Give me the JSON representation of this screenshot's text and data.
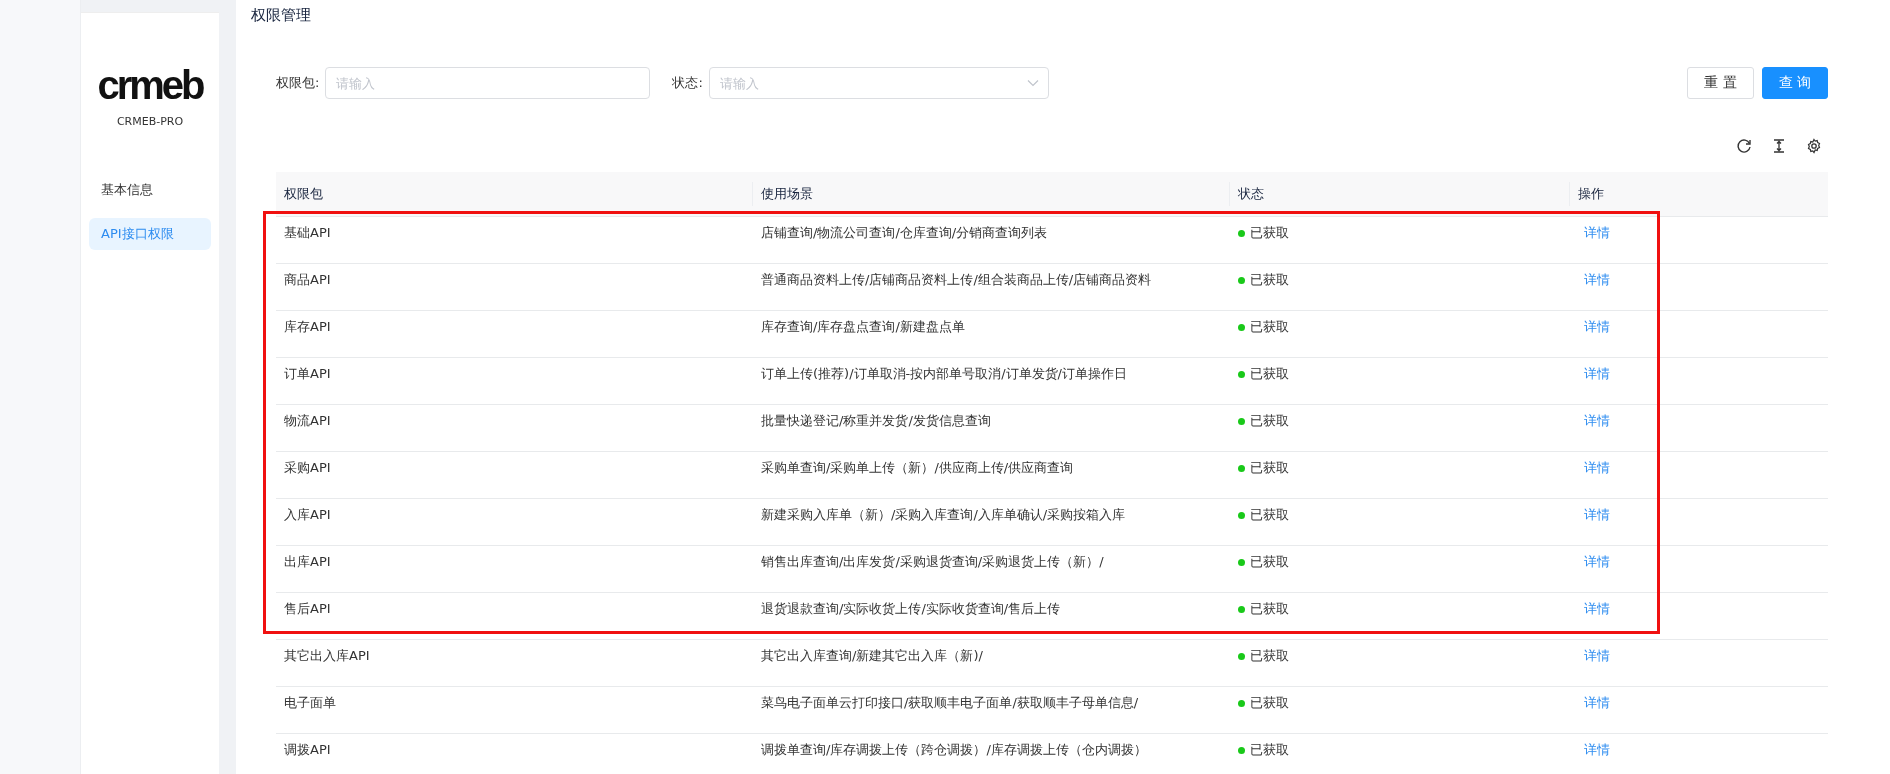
{
  "sidebar": {
    "logo_text": "crmeb",
    "brand": "CRMEB-PRO",
    "items": [
      {
        "label": "基本信息",
        "selected": false
      },
      {
        "label": "API接口权限",
        "selected": true
      }
    ]
  },
  "page_title": "权限管理",
  "filters": [
    {
      "label": "权限包:",
      "placeholder": "请输入",
      "kind": "input"
    },
    {
      "label": "状态:",
      "placeholder": "请输入",
      "kind": "select"
    }
  ],
  "buttons": [
    {
      "label": "重 置",
      "kind": "default"
    },
    {
      "label": "查 询",
      "kind": "primary"
    }
  ],
  "table": {
    "columns": [
      "权限包",
      "使用场景",
      "状态",
      "操作"
    ],
    "rows": [
      {
        "package": "基础API",
        "scenes": "店铺查询/物流公司查询/仓库查询/分销商查询列表",
        "status": "已获取",
        "action": "详情",
        "highlighted": true
      },
      {
        "package": "商品API",
        "scenes": "普通商品资料上传/店铺商品资料上传/组合装商品上传/店铺商品资料",
        "status": "已获取",
        "action": "详情",
        "highlighted": true
      },
      {
        "package": "库存API",
        "scenes": "库存查询/库存盘点查询/新建盘点单",
        "status": "已获取",
        "action": "详情",
        "highlighted": true
      },
      {
        "package": "订单API",
        "scenes": "订单上传(推荐)/订单取消-按内部单号取消/订单发货/订单操作日",
        "status": "已获取",
        "action": "详情",
        "highlighted": true
      },
      {
        "package": "物流API",
        "scenes": "批量快递登记/称重并发货/发货信息查询",
        "status": "已获取",
        "action": "详情",
        "highlighted": true
      },
      {
        "package": "采购API",
        "scenes": "采购单查询/采购单上传（新）/供应商上传/供应商查询",
        "status": "已获取",
        "action": "详情",
        "highlighted": true
      },
      {
        "package": "入库API",
        "scenes": "新建采购入库单（新）/采购入库查询/入库单确认/采购按箱入库",
        "status": "已获取",
        "action": "详情",
        "highlighted": true
      },
      {
        "package": "出库API",
        "scenes": "销售出库查询/出库发货/采购退货查询/采购退货上传（新）/",
        "status": "已获取",
        "action": "详情",
        "highlighted": true
      },
      {
        "package": "售后API",
        "scenes": "退货退款查询/实际收货上传/实际收货查询/售后上传",
        "status": "已获取",
        "action": "详情",
        "highlighted": true
      },
      {
        "package": "其它出入库API",
        "scenes": "其它出入库查询/新建其它出入库（新)/",
        "status": "已获取",
        "action": "详情",
        "highlighted": false
      },
      {
        "package": "电子面单",
        "scenes": "菜鸟电子面单云打印接口/获取顺丰电子面单/获取顺丰子母单信息/",
        "status": "已获取",
        "action": "详情",
        "highlighted": false
      },
      {
        "package": "调拨API",
        "scenes": "调拨单查询/库存调拨上传（跨仓调拨）/库存调拨上传（仓内调拨）",
        "status": "已获取",
        "action": "详情",
        "highlighted": false
      }
    ]
  }
}
